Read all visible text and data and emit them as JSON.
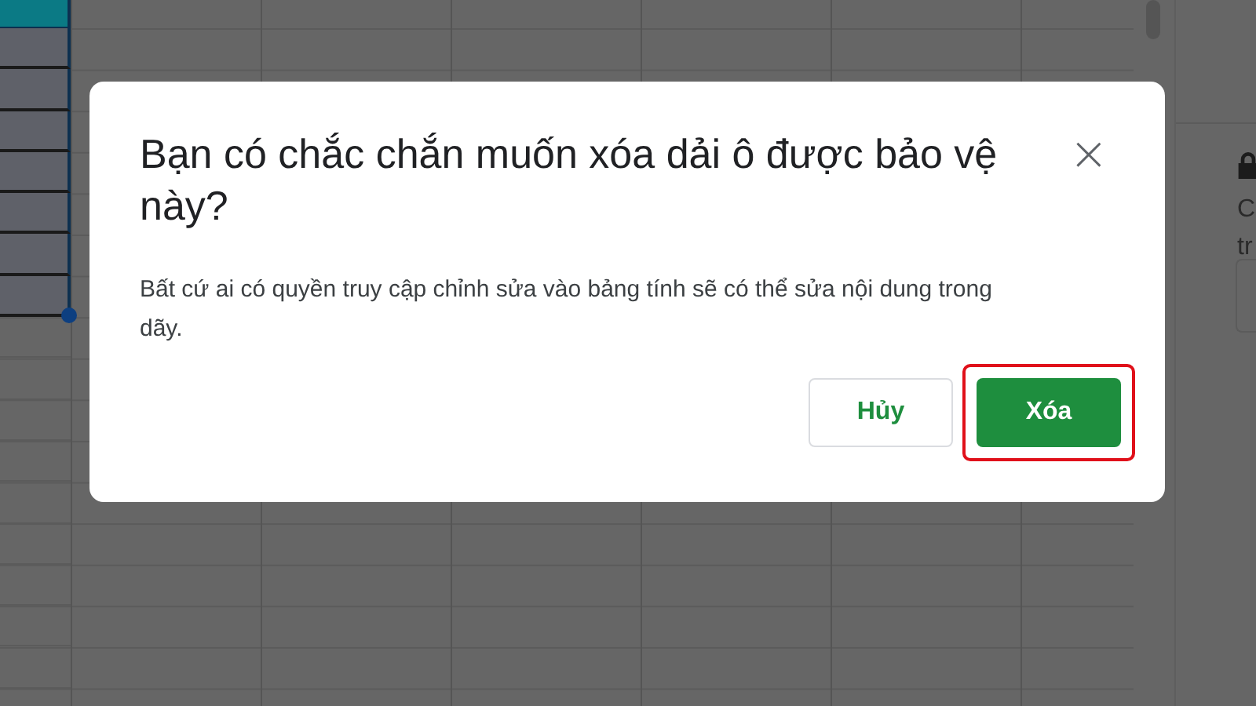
{
  "sheet": {
    "cells": [
      {
        "kind": "active"
      },
      {
        "kind": "selected"
      },
      {
        "kind": "selected"
      },
      {
        "kind": "selected"
      },
      {
        "kind": "selected"
      },
      {
        "kind": "selected"
      },
      {
        "kind": "selected"
      },
      {
        "kind": "selected"
      },
      {
        "kind": "plain"
      },
      {
        "kind": "plain"
      },
      {
        "kind": "plain"
      },
      {
        "kind": "plain"
      },
      {
        "kind": "plain"
      },
      {
        "kind": "plain"
      },
      {
        "kind": "plain"
      },
      {
        "kind": "plain"
      },
      {
        "kind": "plain"
      }
    ]
  },
  "side_panel": {
    "lines": [
      "C",
      "tr"
    ]
  },
  "dialog": {
    "title": "Bạn có chắc chắn muốn xóa dải ô được bảo vệ này?",
    "close": "×",
    "message": "Bất cứ ai có quyền truy cập chỉnh sửa vào bảng tính sẽ có thể sửa nội dung trong dãy.",
    "buttons": [
      {
        "label": "Hủy",
        "kind": "secondary",
        "highlighted": false
      },
      {
        "label": "Xóa",
        "kind": "primary",
        "highlighted": true
      }
    ]
  }
}
